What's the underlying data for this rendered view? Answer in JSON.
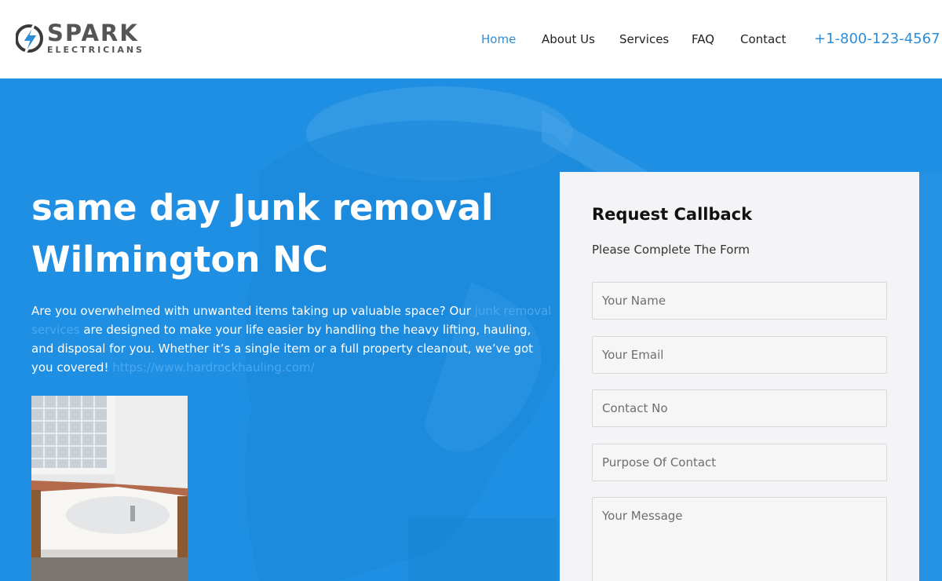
{
  "brand": {
    "name": "SPARK",
    "tagline": "ELECTRICIANS",
    "primary_color": "#2f8dd6",
    "text_color": "#555555"
  },
  "nav": {
    "items": [
      {
        "label": "Home",
        "active": true
      },
      {
        "label": "About Us",
        "active": false
      },
      {
        "label": "Services",
        "active": false
      },
      {
        "label": "FAQ",
        "active": false
      },
      {
        "label": "Contact",
        "active": false
      }
    ],
    "phone": "+1-800-123-4567"
  },
  "hero": {
    "background_color": "#1f8fe3",
    "title": "same day Junk removal Wilmington NC",
    "text_before_link": "Are you overwhelmed with unwanted items taking up valuable space? Our ",
    "link_text": "junk removal services",
    "text_after_link": " are designed to make your life easier by handling the heavy lifting, hauling, and disposal for you. Whether it’s a single item or a full property cleanout, we’ve got you covered! ",
    "url_text": "https://www.hardrockhauling.com/",
    "photo_icon": "bathtub-photo"
  },
  "form": {
    "title": "Request Callback",
    "subtitle": "Please Complete The Form",
    "name_placeholder": "Your Name",
    "email_placeholder": "Your Email",
    "contact_placeholder": "Contact No",
    "purpose_placeholder": "Purpose Of Contact",
    "message_placeholder": "Your Message"
  }
}
